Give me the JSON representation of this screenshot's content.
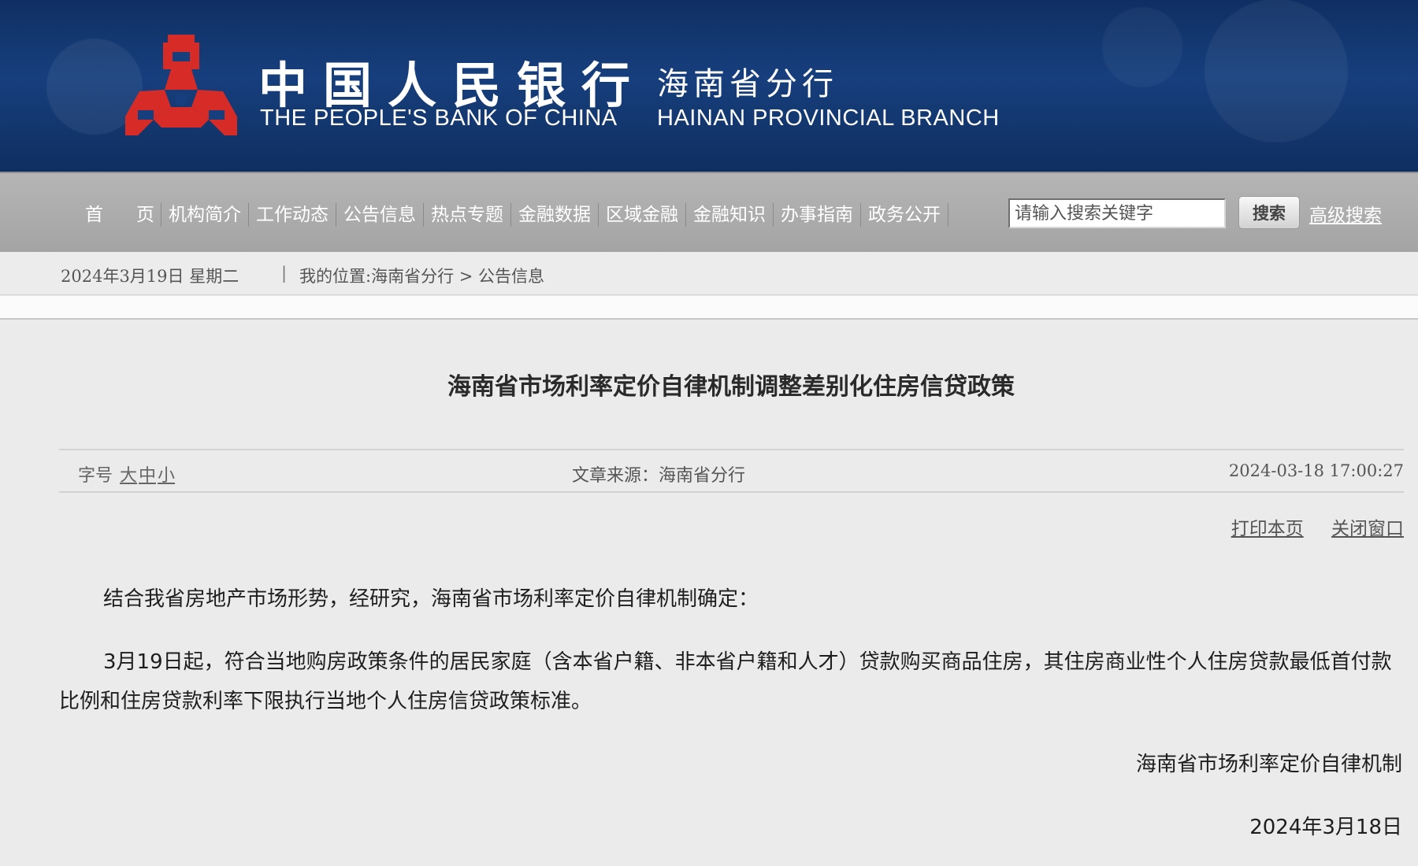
{
  "header": {
    "cn_name": "中国人民银行",
    "en_name": "THE PEOPLE'S BANK OF CHINA",
    "branch_cn": "海南省分行",
    "branch_en": "HAINAN PROVINCIAL BRANCH",
    "logo_icon": "pboc-emblem-icon",
    "logo_color": "#d62b27"
  },
  "nav": {
    "home": [
      "首",
      "页"
    ],
    "items": [
      "机构简介",
      "工作动态",
      "公告信息",
      "热点专题",
      "金融数据",
      "区域金融",
      "金融知识",
      "办事指南",
      "政务公开"
    ],
    "search_placeholder": "请输入搜索关键字",
    "search_button": "搜索",
    "advanced_search": "高级搜索"
  },
  "crumb": {
    "date": "2024年3月19日 星期二",
    "separator": "|",
    "location": "我的位置:海南省分行 > 公告信息"
  },
  "article": {
    "title": "海南省市场利率定价自律机制调整差别化住房信贷政策",
    "font_size_label": "字号",
    "font_large": "大",
    "font_medium": "中",
    "font_small": "小",
    "source": "文章来源：海南省分行",
    "pubtime": "2024-03-18 17:00:27",
    "print": "打印本页",
    "close": "关闭窗口",
    "para1": "结合我省房地产市场形势，经研究，海南省市场利率定价自律机制确定：",
    "para2": "3月19日起，符合当地购房政策条件的居民家庭（含本省户籍、非本省户籍和人才）贷款购买商品住房，其住房商业性个人住房贷款最低首付款比例和住房贷款利率下限执行当地个人住房信贷政策标准。",
    "sign_org": "海南省市场利率定价自律机制",
    "sign_date": "2024年3月18日"
  }
}
